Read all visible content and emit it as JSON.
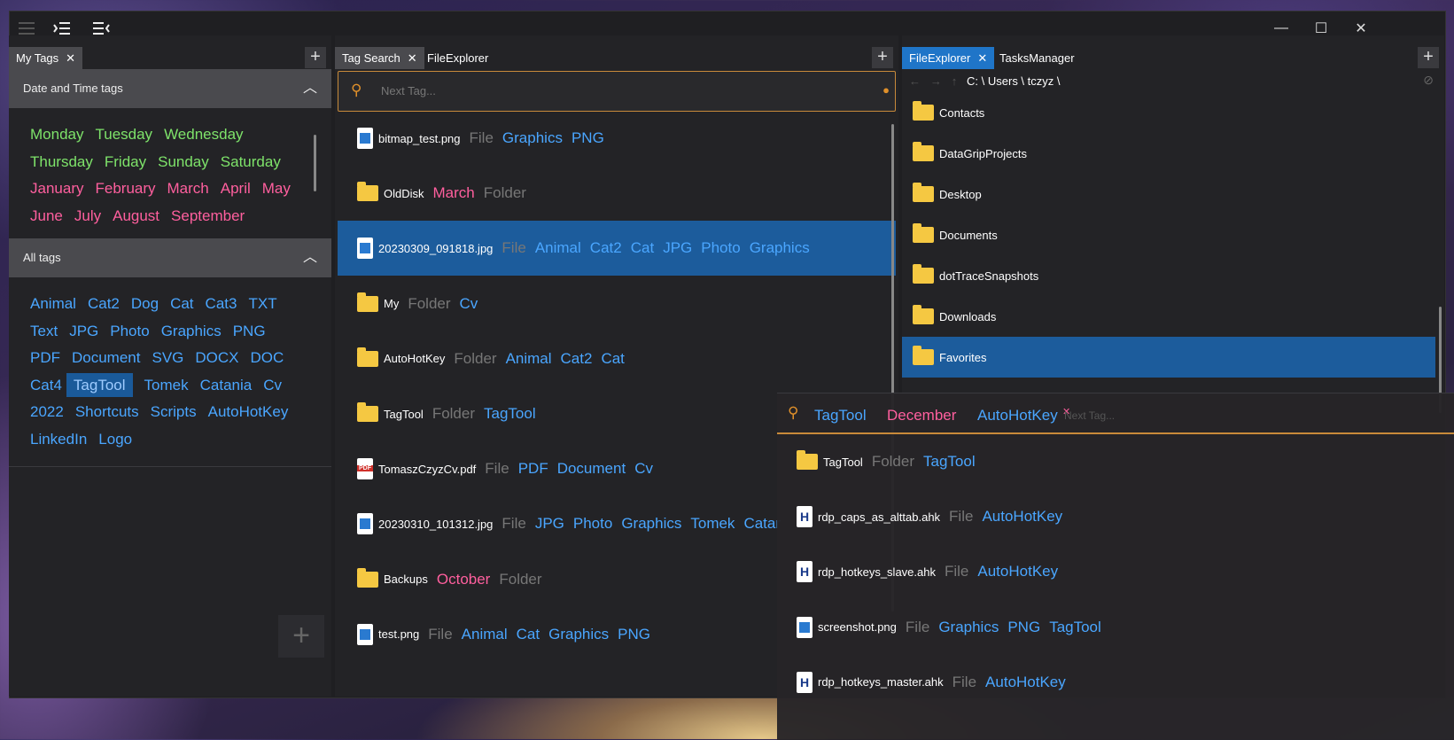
{
  "colors": {
    "accent_blue": "#1f75c8",
    "tag_blue": "#4aa6ff",
    "tag_green": "#7ee36a",
    "tag_pink": "#ff5f9e",
    "search_border": "#c88a3a"
  },
  "titlebar": {
    "icons": [
      "hamburger-menu-icon",
      "expand-panel-icon",
      "collapse-panel-icon"
    ],
    "controls": [
      "—",
      "☐",
      "✕"
    ]
  },
  "left_panel": {
    "tab": "My Tags",
    "date_section": "Date and Time tags",
    "date_rows": [
      [
        {
          "t": "Monday",
          "c": "green"
        },
        {
          "t": "Tuesday",
          "c": "green"
        },
        {
          "t": "Wednesday",
          "c": "green"
        }
      ],
      [
        {
          "t": "Thursday",
          "c": "green"
        },
        {
          "t": "Friday",
          "c": "green"
        },
        {
          "t": "Sunday",
          "c": "green"
        },
        {
          "t": "Saturday",
          "c": "green"
        }
      ],
      [
        {
          "t": "January",
          "c": "pink"
        },
        {
          "t": "February",
          "c": "pink"
        },
        {
          "t": "March",
          "c": "pink"
        },
        {
          "t": "April",
          "c": "pink"
        },
        {
          "t": "May",
          "c": "pink"
        }
      ],
      [
        {
          "t": "June",
          "c": "pink"
        },
        {
          "t": "July",
          "c": "pink"
        },
        {
          "t": "August",
          "c": "pink"
        },
        {
          "t": "September",
          "c": "pink"
        }
      ]
    ],
    "all_section": "All tags",
    "all_rows": [
      [
        "Animal",
        "Cat2",
        "Dog",
        "Cat",
        "Cat3",
        "TXT"
      ],
      [
        "Text",
        "JPG",
        "Photo",
        "Graphics",
        "PNG"
      ],
      [
        "PDF",
        "Document",
        "SVG",
        "DOCX",
        "DOC"
      ],
      [
        "Cat4",
        "TagTool",
        "Tomek",
        "Catania",
        "Cv"
      ],
      [
        "2022",
        "Shortcuts",
        "Scripts",
        "AutoHotKey"
      ],
      [
        "LinkedIn",
        "Logo"
      ]
    ],
    "selected_tag": "TagTool",
    "add_button": "+"
  },
  "middle_panel": {
    "tabs": [
      "Tag Search",
      "FileExplorer"
    ],
    "search_placeholder": "Next Tag...",
    "results": [
      {
        "icon": "image-file-icon",
        "name": "bitmap_test.png",
        "tags": [
          {
            "t": "File",
            "c": "grey"
          },
          {
            "t": "Graphics",
            "c": "blue"
          },
          {
            "t": "PNG",
            "c": "blue"
          }
        ]
      },
      {
        "icon": "folder-icon",
        "name": "OldDisk",
        "tags": [
          {
            "t": "March",
            "c": "pink"
          },
          {
            "t": "Folder",
            "c": "grey"
          }
        ]
      },
      {
        "icon": "image-file-icon",
        "name": "20230309_091818.jpg",
        "sel": true,
        "tags": [
          {
            "t": "File",
            "c": "grey"
          },
          {
            "t": "Animal",
            "c": "blue"
          },
          {
            "t": "Cat2",
            "c": "blue"
          },
          {
            "t": "Cat",
            "c": "blue"
          },
          {
            "t": "JPG",
            "c": "blue"
          },
          {
            "t": "Photo",
            "c": "blue"
          },
          {
            "t": "Graphics",
            "c": "blue"
          }
        ]
      },
      {
        "icon": "folder-icon",
        "name": "My",
        "tags": [
          {
            "t": "Folder",
            "c": "grey"
          },
          {
            "t": "Cv",
            "c": "blue"
          }
        ]
      },
      {
        "icon": "folder-icon",
        "name": "AutoHotKey",
        "tags": [
          {
            "t": "Folder",
            "c": "grey"
          },
          {
            "t": "Animal",
            "c": "blue"
          },
          {
            "t": "Cat2",
            "c": "blue"
          },
          {
            "t": "Cat",
            "c": "blue"
          }
        ]
      },
      {
        "icon": "folder-icon",
        "name": "TagTool",
        "tags": [
          {
            "t": "Folder",
            "c": "grey"
          },
          {
            "t": "TagTool",
            "c": "blue"
          }
        ]
      },
      {
        "icon": "pdf-file-icon",
        "name": "TomaszCzyzCv.pdf",
        "tags": [
          {
            "t": "File",
            "c": "grey"
          },
          {
            "t": "PDF",
            "c": "blue"
          },
          {
            "t": "Document",
            "c": "blue"
          },
          {
            "t": "Cv",
            "c": "blue"
          }
        ]
      },
      {
        "icon": "image-file-icon",
        "name": "20230310_101312.jpg",
        "tags": [
          {
            "t": "File",
            "c": "grey"
          },
          {
            "t": "JPG",
            "c": "blue"
          },
          {
            "t": "Photo",
            "c": "blue"
          },
          {
            "t": "Graphics",
            "c": "blue"
          },
          {
            "t": "Tomek",
            "c": "blue"
          },
          {
            "t": "Catar",
            "c": "blue"
          }
        ]
      },
      {
        "icon": "folder-icon",
        "name": "Backups",
        "tags": [
          {
            "t": "October",
            "c": "pink"
          },
          {
            "t": "Folder",
            "c": "grey"
          }
        ]
      },
      {
        "icon": "image-file-icon",
        "name": "test.png",
        "tags": [
          {
            "t": "File",
            "c": "grey"
          },
          {
            "t": "Animal",
            "c": "blue"
          },
          {
            "t": "Cat",
            "c": "blue"
          },
          {
            "t": "Graphics",
            "c": "blue"
          },
          {
            "t": "PNG",
            "c": "blue"
          }
        ]
      }
    ]
  },
  "right_panel": {
    "tabs": [
      "FileExplorer",
      "TasksManager"
    ],
    "path": "C: \\ Users \\ tczyz \\",
    "items": [
      {
        "name": "Contacts"
      },
      {
        "name": "DataGripProjects"
      },
      {
        "name": "Desktop"
      },
      {
        "name": "Documents"
      },
      {
        "name": "dotTraceSnapshots"
      },
      {
        "name": "Downloads"
      },
      {
        "name": "Favorites",
        "sel": true
      }
    ]
  },
  "popup": {
    "chips": [
      {
        "t": "TagTool",
        "c": "blue"
      },
      {
        "t": "December",
        "c": "pink"
      },
      {
        "t": "AutoHotKey",
        "c": "blue"
      }
    ],
    "placeholder": "Next Tag...",
    "results": [
      {
        "icon": "folder-icon",
        "name": "TagTool",
        "tags": [
          {
            "t": "Folder",
            "c": "grey"
          },
          {
            "t": "TagTool",
            "c": "blue"
          }
        ]
      },
      {
        "icon": "ahk-file-icon",
        "name": "rdp_caps_as_alttab.ahk",
        "tags": [
          {
            "t": "File",
            "c": "grey"
          },
          {
            "t": "AutoHotKey",
            "c": "blue"
          }
        ]
      },
      {
        "icon": "ahk-file-icon",
        "name": "rdp_hotkeys_slave.ahk",
        "tags": [
          {
            "t": "File",
            "c": "grey"
          },
          {
            "t": "AutoHotKey",
            "c": "blue"
          }
        ]
      },
      {
        "icon": "image-file-icon",
        "name": "screenshot.png",
        "tags": [
          {
            "t": "File",
            "c": "grey"
          },
          {
            "t": "Graphics",
            "c": "blue"
          },
          {
            "t": "PNG",
            "c": "blue"
          },
          {
            "t": "TagTool",
            "c": "blue"
          }
        ]
      },
      {
        "icon": "ahk-file-icon",
        "name": "rdp_hotkeys_master.ahk",
        "tags": [
          {
            "t": "File",
            "c": "grey"
          },
          {
            "t": "AutoHotKey",
            "c": "blue"
          }
        ]
      }
    ]
  }
}
